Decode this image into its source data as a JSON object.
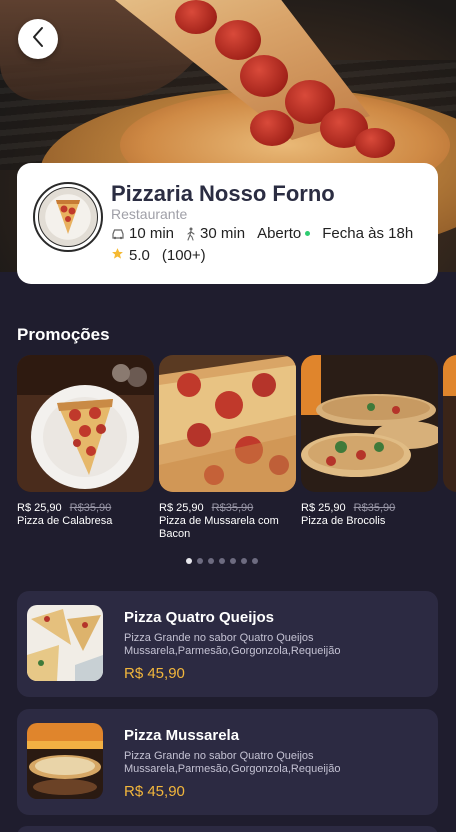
{
  "header": {
    "back_icon": "chevron-left-icon"
  },
  "restaurant": {
    "name": "Pizzaria Nosso Forno",
    "type": "Restaurante",
    "delivery_time": "10 min",
    "walk_time": "30 min",
    "status": "Aberto",
    "closes": "Fecha às 18h",
    "rating": "5.0",
    "reviews": "(100+)",
    "status_color": "#2ecc71",
    "rating_color": "#f5b932"
  },
  "promotions": {
    "title": "Promoções",
    "items": [
      {
        "price": "R$ 25,90",
        "old_price": "R$35,90",
        "name": "Pizza de Calabresa"
      },
      {
        "price": "R$ 25,90",
        "old_price": "R$35,90",
        "name": "Pizza de Mussarela com Bacon"
      },
      {
        "price": "R$ 25,90",
        "old_price": "R$35,90",
        "name": "Pizza de Brocolis"
      }
    ],
    "page_count": 7,
    "active_page": 1
  },
  "products": [
    {
      "name": "Pizza Quatro Queijos",
      "desc_line1": "Pizza Grande no sabor Quatro Queijos",
      "desc_line2": "Mussarela,Parmesão,Gorgonzola,Requeijão",
      "price": "R$ 45,90"
    },
    {
      "name": "Pizza Mussarela",
      "desc_line1": "Pizza Grande no sabor Quatro Queijos",
      "desc_line2": "Mussarela,Parmesão,Gorgonzola,Requeijão",
      "price": "R$ 45,90"
    }
  ],
  "colors": {
    "background": "#1f1d2e",
    "card": "#2c2a42",
    "price_accent": "#f2b63c"
  }
}
